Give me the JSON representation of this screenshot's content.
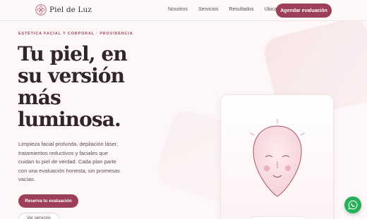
{
  "brand": {
    "name": "Piel de Luz",
    "logo_icon": "flower-logo-icon"
  },
  "nav": {
    "items": [
      "Nosotros",
      "Servicios",
      "Resultados",
      "Ubicación"
    ]
  },
  "header": {
    "cta_label": "Agendar evaluación"
  },
  "hero": {
    "eyebrow": "ESTÉTICA FACIAL Y CORPORAL · PROVIDENCIA",
    "title_lines": [
      "Tu piel, en",
      "su versión",
      "más",
      "luminosa."
    ],
    "lead": "Limpieza facial profunda, depilación láser, tratamientos reductivos y faciales que cuidan tu piel de verdad. Cada plan parte con una evaluación honesta, sin promesas vacías.",
    "primary_cta": "Reserva tu evaluación",
    "secondary_cta": "Ver servicios"
  },
  "illustration": {
    "icon": "face-illustration-icon"
  },
  "floating": {
    "icon": "whatsapp-icon"
  },
  "colors": {
    "accent": "#9e3f5a",
    "background": "#fdf7f7",
    "whatsapp": "#25b15a"
  }
}
